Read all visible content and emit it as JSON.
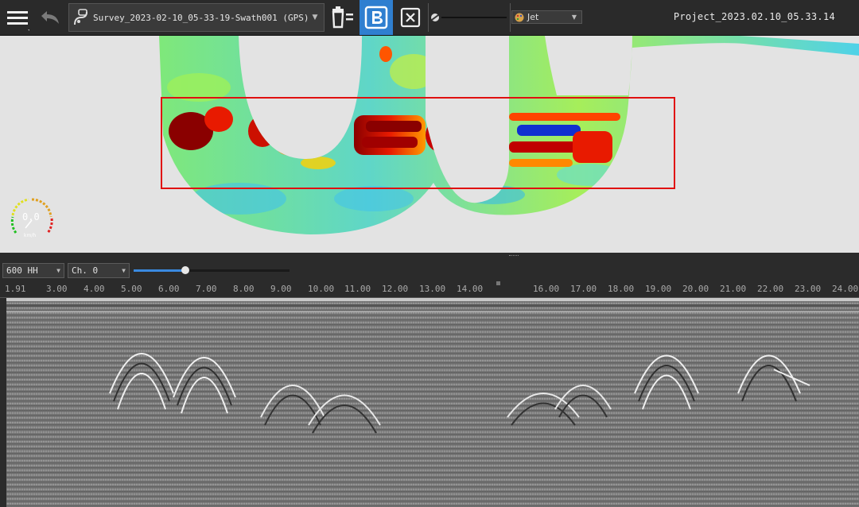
{
  "toolbar": {
    "survey_name": "Survey_2023-02-10_05-33-19-Swath001 (GPS)",
    "colormap_label": "Jet",
    "project_title": "Project_2023.02.10_05.33.14"
  },
  "speedometer": {
    "value": "0.0",
    "unit": "km/h"
  },
  "controls": {
    "frequency_label": "600 HH",
    "channel_label": "Ch. 0",
    "gain_level": 0.33
  },
  "ruler": {
    "ticks": [
      "1.91",
      "3.00",
      "4.00",
      "5.00",
      "6.00",
      "7.00",
      "8.00",
      "9.00",
      "10.00",
      "11.00",
      "12.00",
      "13.00",
      "14.00",
      "16.00",
      "17.00",
      "18.00",
      "19.00",
      "20.00",
      "21.00",
      "22.00",
      "23.00",
      "24.00"
    ]
  },
  "colors": {
    "toolbar_bg": "#2a2a2a",
    "map_bg": "#e3e3e3",
    "selection_box": "#e01010",
    "active_button": "#2f7fd0",
    "slider_fill": "#3a8ae0"
  }
}
